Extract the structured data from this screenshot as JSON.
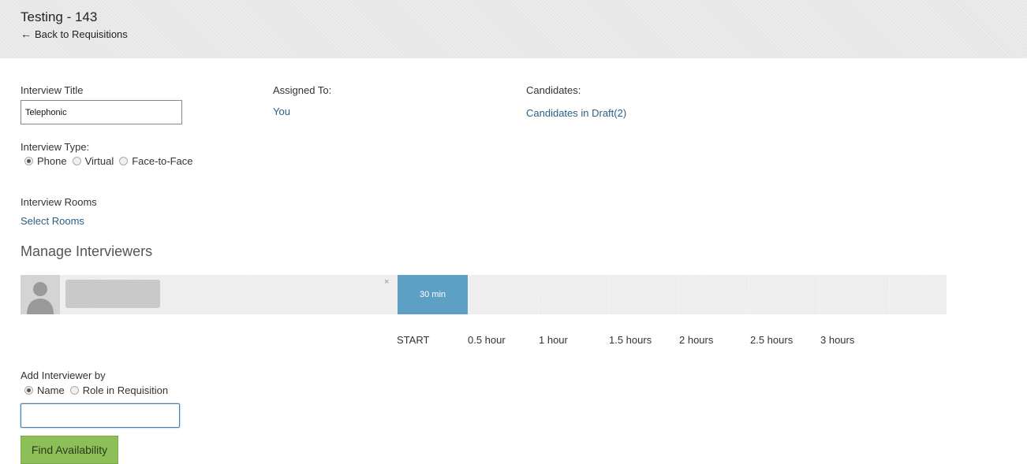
{
  "header": {
    "title": "Testing - 143",
    "back_arrow": "←",
    "back_label": "Back to Requisitions"
  },
  "form": {
    "title_label": "Interview Title",
    "title_value": "Telephonic",
    "assigned_label": "Assigned To:",
    "assigned_value": "You",
    "candidates_label": "Candidates:",
    "candidates_link": "Candidates in Draft(2)",
    "type_label": "Interview Type:",
    "type_options": [
      "Phone",
      "Virtual",
      "Face-to-Face"
    ],
    "type_selected": "Phone",
    "rooms_label": "Interview Rooms",
    "rooms_link": "Select Rooms"
  },
  "interviewers": {
    "heading": "Manage Interviewers",
    "remove_glyph": "×",
    "slot_label": "30 min",
    "timeline_ticks": [
      "START",
      "0.5 hour",
      "1 hour",
      "1.5 hours",
      "2 hours",
      "2.5 hours",
      "3 hours"
    ]
  },
  "add_interviewer": {
    "label": "Add Interviewer by",
    "options": [
      "Name",
      "Role in Requisition"
    ],
    "selected": "Name",
    "input_value": "",
    "button_label": "Find Availability"
  },
  "icons": {
    "back": "arrow-left-icon",
    "avatar": "user-silhouette-icon",
    "remove": "close-icon"
  }
}
